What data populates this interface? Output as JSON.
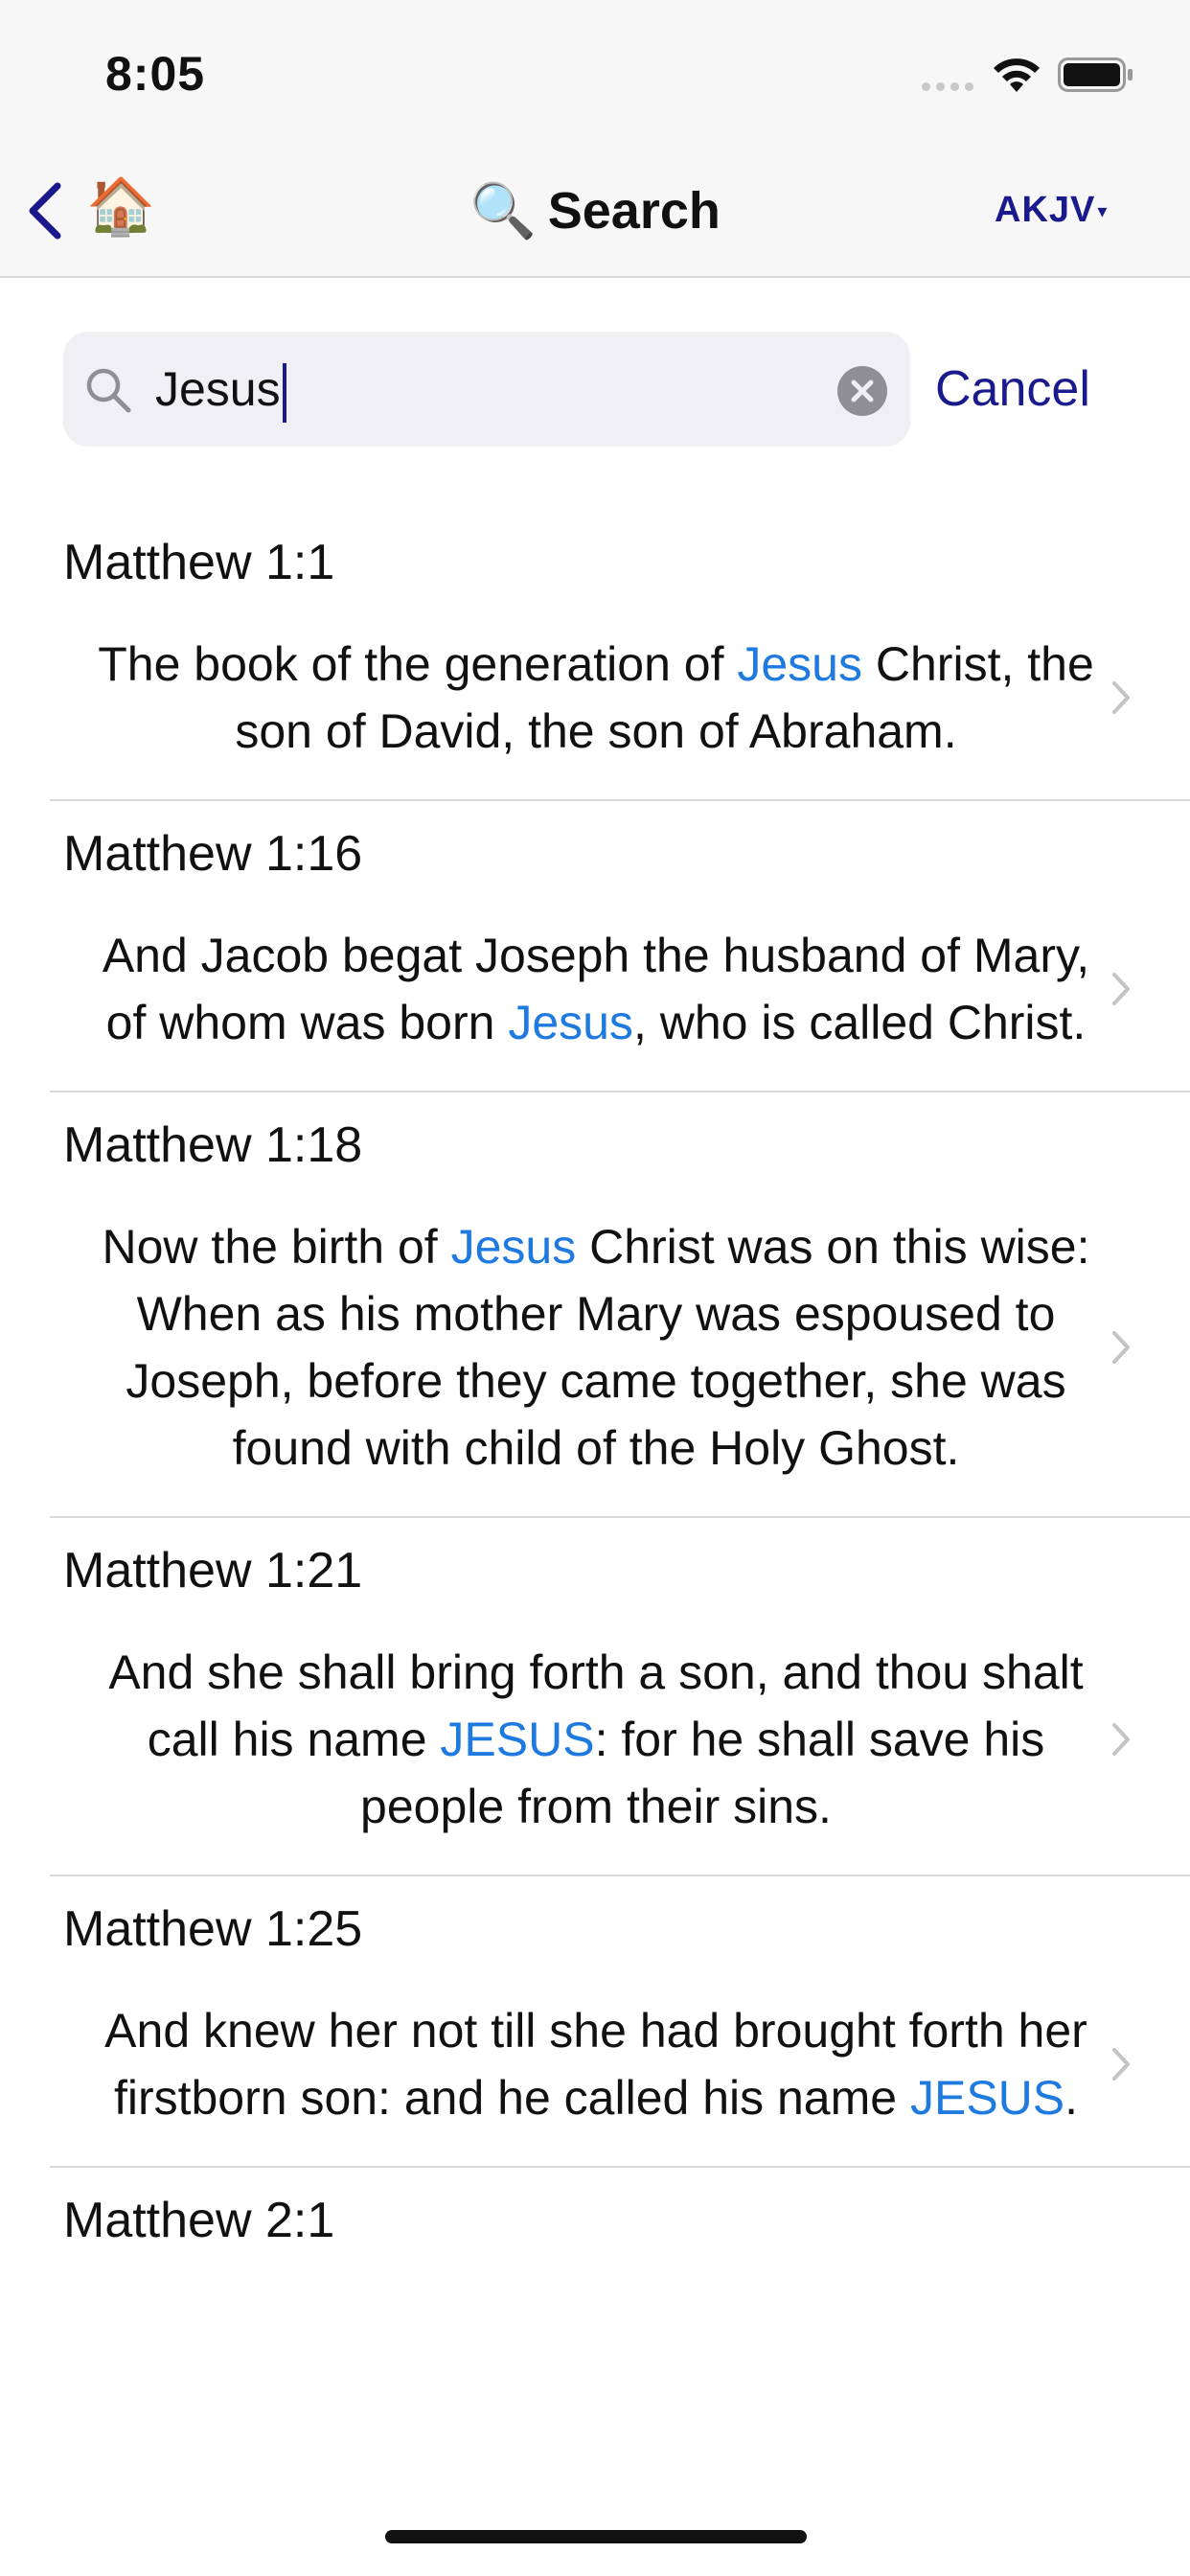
{
  "status_bar": {
    "time": "8:05"
  },
  "nav": {
    "back_icon": "chevron-left-icon",
    "home_icon": "🏠",
    "title_icon": "🔍",
    "title": "Search",
    "version": "AKJV",
    "version_arrow": "▾",
    "accent_color": "#1a1a8c"
  },
  "search": {
    "value": "Jesus",
    "cancel_label": "Cancel"
  },
  "highlight_color": "#1f7ae0",
  "results": [
    {
      "reference": "Matthew 1:1",
      "segments": [
        {
          "text": "The book of the generation of ",
          "hl": false
        },
        {
          "text": "Jesus",
          "hl": true
        },
        {
          "text": " Christ, the son of David, the son of Abraham.",
          "hl": false
        }
      ]
    },
    {
      "reference": "Matthew 1:16",
      "segments": [
        {
          "text": "And Jacob begat Joseph the husband of Mary, of whom was born ",
          "hl": false
        },
        {
          "text": "Jesus",
          "hl": true
        },
        {
          "text": ", who is called Christ.",
          "hl": false
        }
      ]
    },
    {
      "reference": "Matthew 1:18",
      "segments": [
        {
          "text": "Now the birth of ",
          "hl": false
        },
        {
          "text": "Jesus",
          "hl": true
        },
        {
          "text": " Christ was on this wise: When as his mother Mary was espoused to Joseph, before they came together, she was found with child of the Holy Ghost.",
          "hl": false
        }
      ]
    },
    {
      "reference": "Matthew 1:21",
      "segments": [
        {
          "text": "And she shall bring forth a son, and thou shalt call his name ",
          "hl": false
        },
        {
          "text": "JESUS",
          "hl": true
        },
        {
          "text": ": for he shall save his people from their sins.",
          "hl": false
        }
      ]
    },
    {
      "reference": "Matthew 1:25",
      "segments": [
        {
          "text": "And knew her not till she had brought forth her firstborn son: and he called his name ",
          "hl": false
        },
        {
          "text": "JESUS",
          "hl": true
        },
        {
          "text": ".",
          "hl": false
        }
      ]
    },
    {
      "reference": "Matthew 2:1",
      "segments": []
    }
  ]
}
